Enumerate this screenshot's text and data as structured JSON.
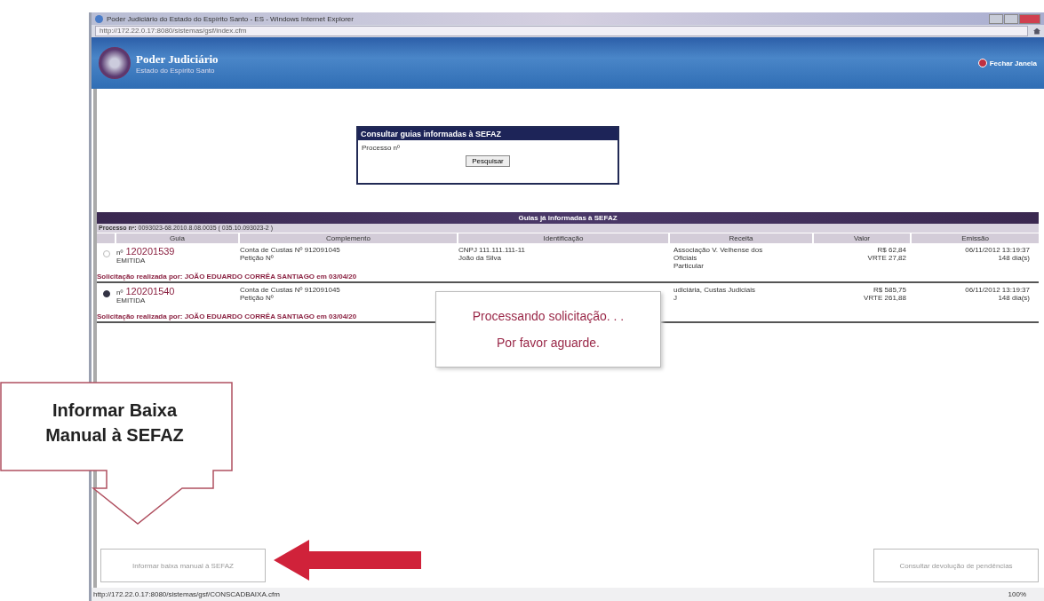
{
  "window": {
    "title": "Poder Judiciário do Estado do Espírito Santo - ES - Windows Internet Explorer",
    "address": "http://172.22.0.17:8080/sistemas/gsf/index.cfm"
  },
  "header": {
    "title": "Poder Judiciário",
    "subtitle": "Estado do Espírito Santo",
    "close_link": "Fechar Janela"
  },
  "search_panel": {
    "title": "Consultar guias informadas à SEFAZ",
    "label": "Processo nº",
    "button": "Pesquisar"
  },
  "results": {
    "title": "Guias já informadas à SEFAZ",
    "processo_label": "Processo nº:",
    "processo": "0093023-68.2010.8.08.0035 ( 035.10.093023-2 )",
    "columns": [
      "Guia",
      "Complemento",
      "Identificação",
      "Receita",
      "Valor",
      "Emissão"
    ],
    "rows": [
      {
        "selected": false,
        "number_prefix": "nº",
        "number": "120201539",
        "status": "EMITIDA",
        "complemento": [
          "Conta de Custas Nº 912091045",
          "Petição Nº"
        ],
        "identificacao": [
          "CNPJ 111.111.111-11",
          "João da Silva"
        ],
        "receita": [
          "Associação V. Velhense dos",
          "Oficiais",
          "Particular"
        ],
        "valor": [
          "R$ 62,84",
          "VRTE 27,82"
        ],
        "emissao": [
          "06/11/2012 13:19:37",
          "148 dia(s)"
        ],
        "solicitacao": "Solicitação realizada por: JOÃO EDUARDO CORRÊA SANTIAGO em 03/04/20"
      },
      {
        "selected": true,
        "number_prefix": "nº",
        "number": "120201540",
        "status": "EMITIDA",
        "complemento": [
          "Conta de Custas Nº 912091045",
          "Petição Nº"
        ],
        "identificacao": [],
        "receita": [
          "udiciária, Custas Judiciais",
          "J"
        ],
        "valor": [
          "R$ 585,75",
          "VRTE 261,88"
        ],
        "emissao": [
          "06/11/2012 13:19:37",
          "148 dia(s)"
        ],
        "solicitacao": "Solicitação realizada por: JOÃO EDUARDO CORRÊA SANTIAGO em 03/04/20"
      }
    ]
  },
  "loading": {
    "lines": [
      "Processando solicitação. . .",
      "Por favor aguarde."
    ]
  },
  "callout": {
    "text": "Informar Baixa Manual à SEFAZ"
  },
  "buttons": [
    {
      "label": "Informar baixa manual à SEFAZ",
      "disabled": true
    },
    {
      "label": "Consultar devolução de pendências",
      "disabled": true
    }
  ],
  "status_bar": {
    "url": "http://172.22.0.17:8080/sistemas/gsf/CONSCADBAIXA.cfm",
    "zoom": "100%"
  }
}
